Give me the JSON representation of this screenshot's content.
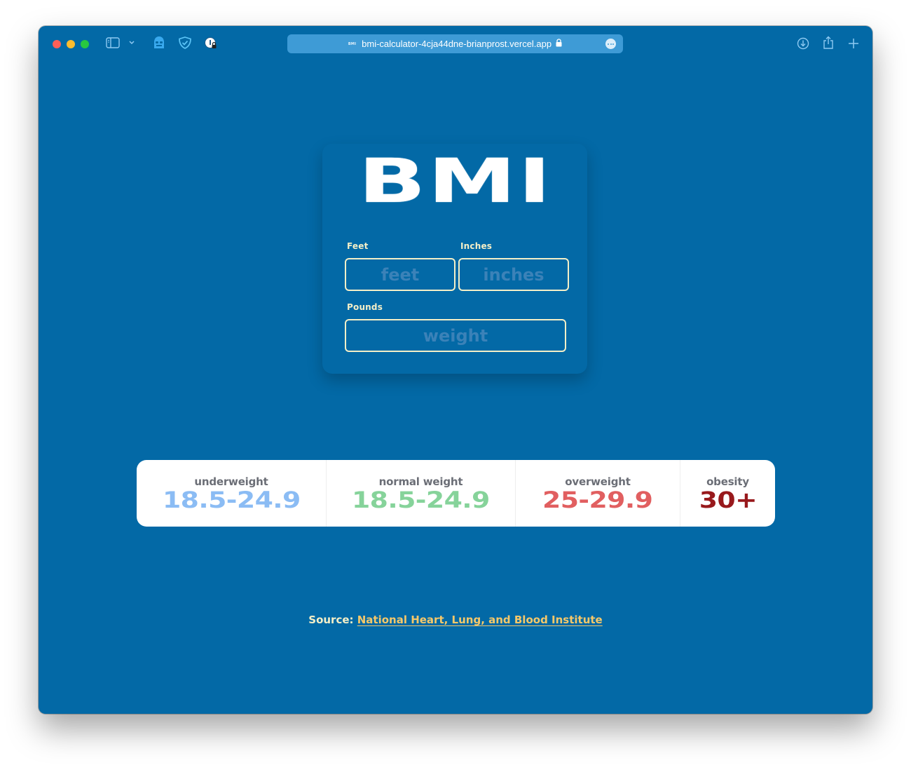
{
  "browser": {
    "url": "bmi-calculator-4cja44dne-brianprost.vercel.app",
    "favicon_text": "BMI",
    "toolbar_icons": {
      "sidebar": "sidebar-icon",
      "tab_overview": "chevron-down-icon",
      "ghost_extension": "ghostery-icon",
      "shield_extension": "shield-check-icon",
      "password_extension": "password-lock-icon",
      "downloads": "download-icon",
      "share": "share-icon",
      "new_tab": "plus-icon",
      "more": "more-icon",
      "secure": "lock-icon"
    }
  },
  "app": {
    "title": "BMI",
    "fields": {
      "feet": {
        "label": "Feet",
        "placeholder": "feet",
        "value": ""
      },
      "inches": {
        "label": "Inches",
        "placeholder": "inches",
        "value": ""
      },
      "pounds": {
        "label": "Pounds",
        "placeholder": "weight",
        "value": ""
      }
    },
    "ranges": [
      {
        "label": "underweight",
        "value": "18.5-24.9",
        "color": "#8bbcf4"
      },
      {
        "label": "normal weight",
        "value": "18.5-24.9",
        "color": "#86d39a"
      },
      {
        "label": "overweight",
        "value": "25-29.9",
        "color": "#e15f60"
      },
      {
        "label": "obesity",
        "value": "30+",
        "color": "#98191c"
      }
    ],
    "source": {
      "label": "Source:",
      "link_text": "National Heart, Lung, and Blood Institute"
    }
  },
  "colors": {
    "background": "#0369a6",
    "label": "#f4efc8",
    "link": "#f5c86a",
    "address_bar": "#3e9bd6"
  }
}
